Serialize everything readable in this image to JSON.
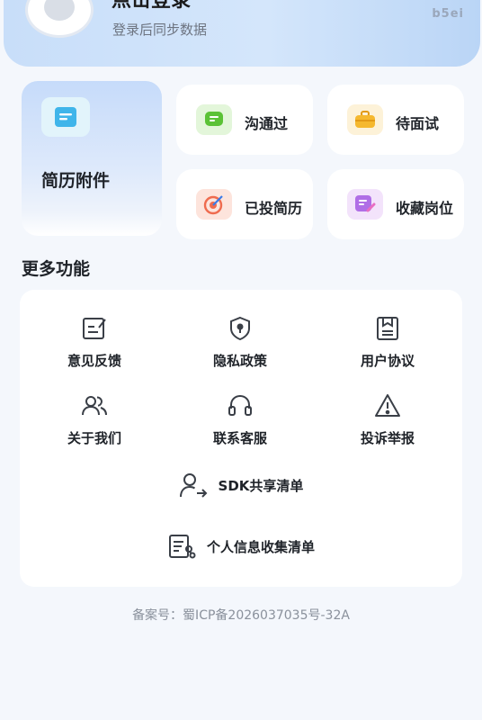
{
  "header": {
    "login_title": "点击登录",
    "login_subtitle": "登录后同步数据",
    "badge": "b5ei"
  },
  "resume_card": {
    "label": "简历附件",
    "icon": "document-icon"
  },
  "status_cards": [
    {
      "label": "沟通过",
      "icon": "chat-bubble-icon",
      "color": "#5bc236"
    },
    {
      "label": "待面试",
      "icon": "briefcase-icon",
      "color": "#f5b82e"
    },
    {
      "label": "已投简历",
      "icon": "target-icon",
      "color": "#ef6b4e"
    },
    {
      "label": "收藏岗位",
      "icon": "bookmark-edit-icon",
      "color": "#b06ee6"
    }
  ],
  "more_section": {
    "title": "更多功能",
    "items": [
      {
        "label": "意见反馈",
        "icon": "feedback-edit-icon"
      },
      {
        "label": "隐私政策",
        "icon": "shield-lock-icon"
      },
      {
        "label": "用户协议",
        "icon": "agreement-doc-icon"
      },
      {
        "label": "关于我们",
        "icon": "users-icon"
      },
      {
        "label": "联系客服",
        "icon": "headset-icon"
      },
      {
        "label": "投诉举报",
        "icon": "warning-triangle-icon"
      }
    ],
    "wide_items": [
      {
        "label": "SDK共享清单",
        "icon": "user-share-icon"
      },
      {
        "label": "个人信息收集清单",
        "icon": "info-list-icon"
      }
    ]
  },
  "footer": {
    "icp": "备案号：蜀ICP备2026037035号-32A"
  }
}
